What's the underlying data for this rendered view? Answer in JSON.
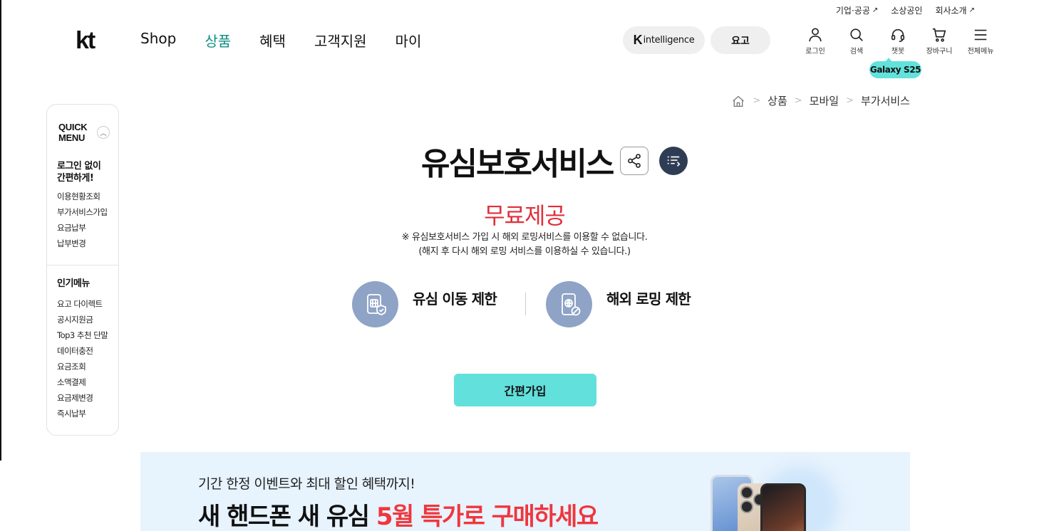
{
  "utility_links": [
    {
      "label": "기업·공공",
      "external": true
    },
    {
      "label": "소상공인",
      "external": false
    },
    {
      "label": "회사소개",
      "external": true
    }
  ],
  "logo": "kt",
  "gnb": {
    "items": [
      "Shop",
      "상품",
      "혜택",
      "고객지원",
      "마이"
    ],
    "active": "상품"
  },
  "pills": {
    "k_letter": "K",
    "k_text": "intelligence",
    "yogo": "요고"
  },
  "header_icons": [
    {
      "icon": "user-icon",
      "label": "로그인"
    },
    {
      "icon": "search-icon",
      "label": "검색"
    },
    {
      "icon": "headset-icon",
      "label": "챗봇"
    },
    {
      "icon": "cart-icon",
      "label": "장바구니"
    },
    {
      "icon": "menu-icon",
      "label": "전체메뉴"
    }
  ],
  "galaxy_badge": "Galaxy S25",
  "breadcrumb": [
    "상품",
    "모바일",
    "부가서비스"
  ],
  "quick_menu": {
    "title_line1": "QUICK",
    "title_line2": "MENU",
    "section1_title_line1": "로그인 없이",
    "section1_title_line2": "간편하게!",
    "section1_items": [
      "이용현황조회",
      "부가서비스가입",
      "요금납부",
      "납부변경"
    ],
    "section2_title": "인기메뉴",
    "section2_items": [
      "요고 다이렉트",
      "공시지원금",
      "Top3 추천 단말",
      "데이터충전",
      "요금조회",
      "소액결제",
      "요금제변경",
      "즉시납부"
    ]
  },
  "main": {
    "title": "유심보호서비스",
    "price": "무료제공",
    "note_line1": "※ 유심보호서비스 가입 시 해외 로밍서비스를 이용할 수 없습니다.",
    "note_line2": "(해지 후 다시 해외 로밍 서비스를 이용하실 수 있습니다.)",
    "features": [
      {
        "icon": "sim-lock-icon",
        "label": "유심 이동 제한"
      },
      {
        "icon": "roaming-block-icon",
        "label": "해외 로밍 제한"
      }
    ],
    "join_button": "간편가입"
  },
  "banner": {
    "sub": "기간 한정 이벤트와 최대 할인 혜택까지!",
    "main_prefix": "새 핸드폰 새 유심 ",
    "main_highlight": "5월 특가로 구매하세요"
  },
  "colors": {
    "accent_teal": "#62e0dc",
    "active_nav": "#0c8e83",
    "price_red": "#e0303a",
    "feature_icon_bg": "#8ea3c6"
  }
}
